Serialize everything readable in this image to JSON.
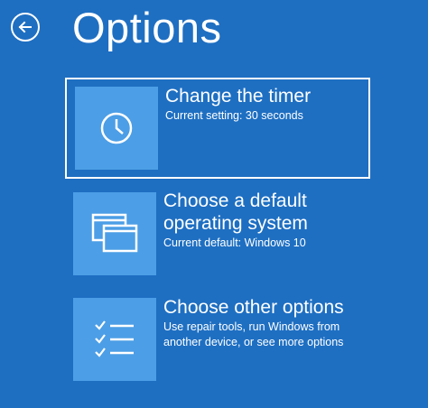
{
  "header": {
    "title": "Options",
    "back_icon": "arrow-left-icon"
  },
  "options": [
    {
      "title": "Change the timer",
      "description": "Current setting: 30 seconds",
      "icon": "clock-icon",
      "selected": true
    },
    {
      "title_line1": "Choose a default",
      "title_line2": "operating system",
      "description": "Current default: Windows 10",
      "icon": "windows-stack-icon",
      "selected": false
    },
    {
      "title": "Choose other options",
      "description_line1": "Use repair tools, run Windows from",
      "description_line2": "another device, or see more options",
      "icon": "checklist-icon",
      "selected": false
    }
  ],
  "colors": {
    "background": "#1e6fc2",
    "tile": "#4c9ee6",
    "text": "#ffffff"
  }
}
